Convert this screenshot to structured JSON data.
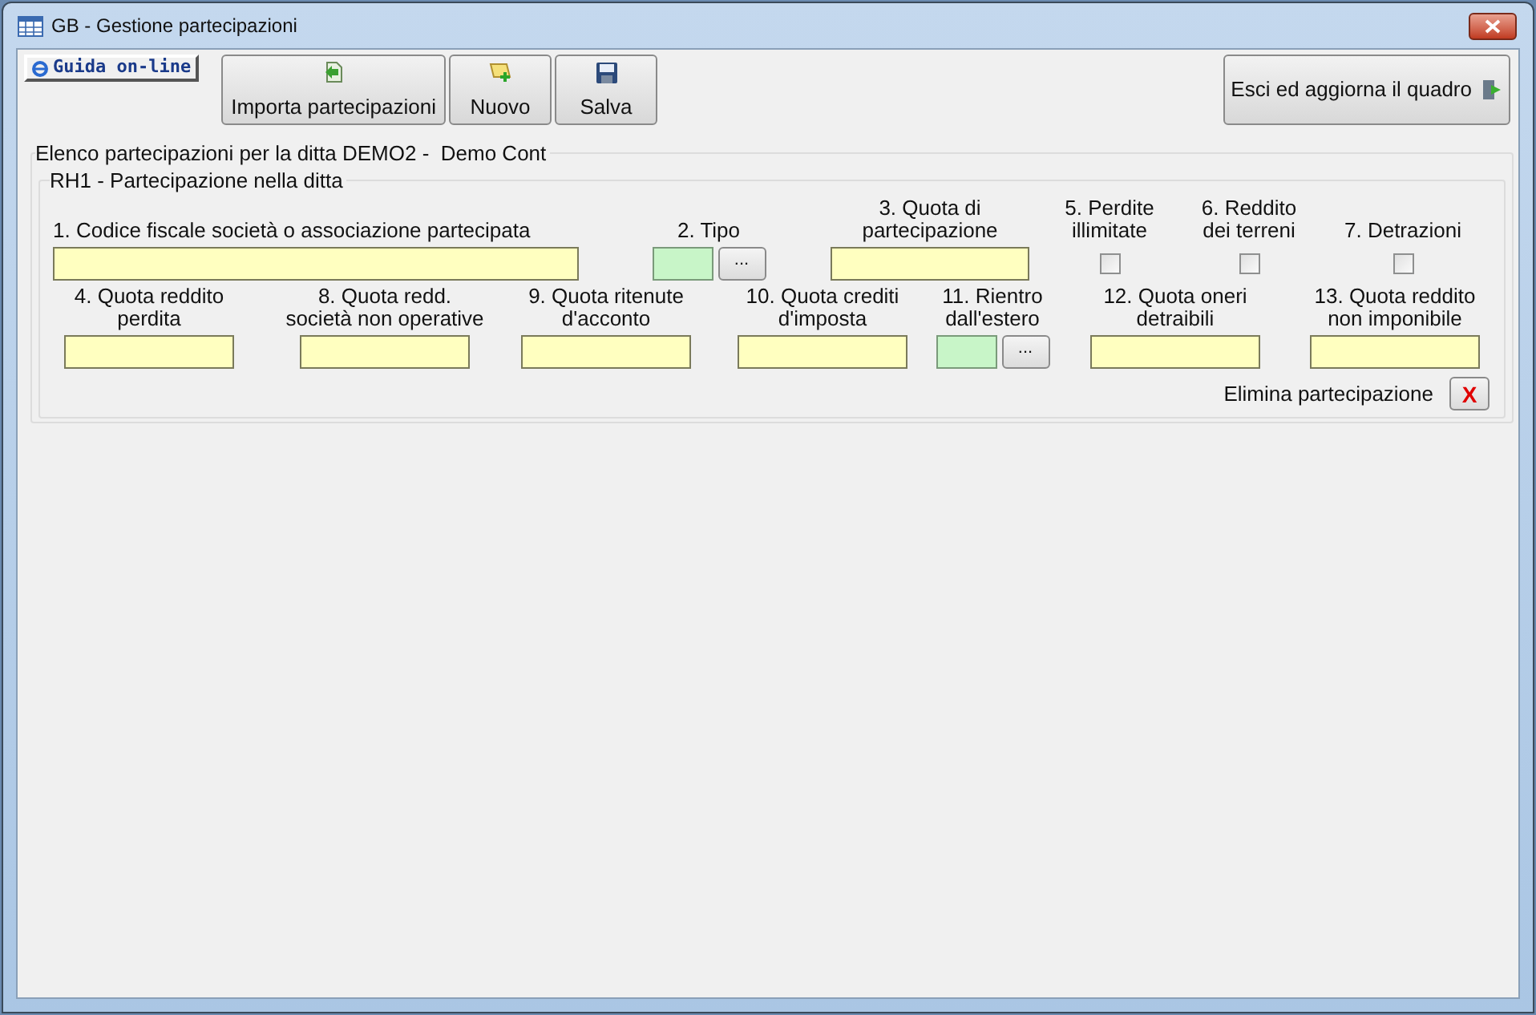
{
  "window": {
    "title": "GB - Gestione partecipazioni"
  },
  "toolbar": {
    "help_button": "Guida on-line",
    "buttons": [
      {
        "label": "Importa partecipazioni"
      },
      {
        "label": "Nuovo"
      },
      {
        "label": "Salva"
      }
    ],
    "exit_button": "Esci ed aggiorna il quadro"
  },
  "heading": "Elenco partecipazioni per la ditta DEMO2 -  Demo Cont",
  "group": {
    "title": "RH1 - Partecipazione nella ditta",
    "row_1": [
      {
        "label": "1. Codice fiscale società o associazione partecipata",
        "kind": "text"
      },
      {
        "label": "2. Tipo",
        "kind": "lookup",
        "button": "..."
      },
      {
        "label": "3. Quota di partecipazione",
        "kind": "text"
      },
      {
        "label": "5. Perdite illimitate",
        "kind": "checkbox",
        "checked": false
      },
      {
        "label": "6. Reddito dei terreni",
        "kind": "checkbox",
        "checked": false
      },
      {
        "label": "7. Detrazioni",
        "kind": "checkbox",
        "checked": false
      }
    ],
    "row_2": [
      {
        "label": "4. Quota reddito perdita",
        "kind": "text"
      },
      {
        "label": "8. Quota redd. società non operative",
        "kind": "text"
      },
      {
        "label": "9. Quota ritenute d'acconto",
        "kind": "text"
      },
      {
        "label": "10. Quota crediti d'imposta",
        "kind": "text"
      },
      {
        "label": "11. Rientro dall'estero",
        "kind": "lookup",
        "button": "..."
      },
      {
        "label": "12. Quota oneri detraibili",
        "kind": "text"
      },
      {
        "label": "13. Quota reddito non imponibile",
        "kind": "text"
      }
    ],
    "delete_label": "Elimina partecipazione",
    "delete_button": "X"
  }
}
